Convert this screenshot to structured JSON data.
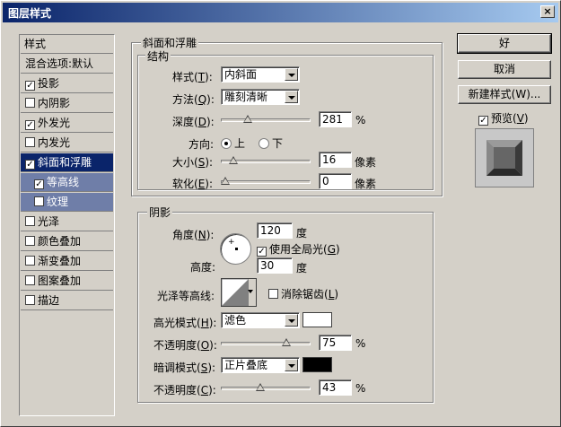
{
  "window": {
    "title": "图层样式",
    "close": "×"
  },
  "sidebar": {
    "items": [
      {
        "label": "样式",
        "checkbox": false
      },
      {
        "label": "混合选项:默认",
        "checkbox": false
      },
      {
        "label": "投影",
        "checkbox": true,
        "checked": true
      },
      {
        "label": "内阴影",
        "checkbox": true,
        "checked": false
      },
      {
        "label": "外发光",
        "checkbox": true,
        "checked": true
      },
      {
        "label": "内发光",
        "checkbox": true,
        "checked": false
      },
      {
        "label": "斜面和浮雕",
        "checkbox": true,
        "checked": true,
        "selected": true
      },
      {
        "label": "等高线",
        "checkbox": true,
        "checked": true,
        "sub": true
      },
      {
        "label": "纹理",
        "checkbox": true,
        "checked": false,
        "sub": true
      },
      {
        "label": "光泽",
        "checkbox": true,
        "checked": false
      },
      {
        "label": "颜色叠加",
        "checkbox": true,
        "checked": false
      },
      {
        "label": "渐变叠加",
        "checkbox": true,
        "checked": false
      },
      {
        "label": "图案叠加",
        "checkbox": true,
        "checked": false
      },
      {
        "label": "描边",
        "checkbox": true,
        "checked": false
      }
    ]
  },
  "bevel": {
    "group_title": "斜面和浮雕",
    "structure_title": "结构",
    "style_label": "样式",
    "style_key": "T",
    "style_value": "内斜面",
    "technique_label": "方法",
    "technique_key": "Q",
    "technique_value": "雕刻清晰",
    "depth_label": "深度",
    "depth_key": "D",
    "depth_value": "281",
    "depth_unit": "%",
    "depth_slider": 0.28,
    "direction_label": "方向:",
    "direction_up": "上",
    "direction_down": "下",
    "size_label": "大小",
    "size_key": "S",
    "size_value": "16",
    "size_unit": "像素",
    "size_slider": 0.1,
    "soften_label": "软化",
    "soften_key": "E",
    "soften_value": "0",
    "soften_unit": "像素",
    "soften_slider": 0.0
  },
  "shading": {
    "title": "阴影",
    "angle_label": "角度",
    "angle_key": "N",
    "angle_value": "120",
    "angle_unit": "度",
    "global_light_label": "使用全局光",
    "global_light_key": "G",
    "altitude_label": "高度:",
    "altitude_value": "30",
    "altitude_unit": "度",
    "gloss_label": "光泽等高线:",
    "antialias_label": "消除锯齿",
    "antialias_key": "L",
    "highlight_label": "高光模式",
    "highlight_key": "H",
    "highlight_value": "滤色",
    "highlight_color": "#ffffff",
    "hl_opacity_label": "不透明度",
    "hl_opacity_key": "O",
    "hl_opacity_value": "75",
    "hl_opacity_unit": "%",
    "hl_opacity_slider": 0.75,
    "shadow_label": "暗调模式",
    "shadow_key": "S",
    "shadow_value": "正片叠底",
    "shadow_color": "#000000",
    "sh_opacity_label": "不透明度",
    "sh_opacity_key": "C",
    "sh_opacity_value": "43",
    "sh_opacity_unit": "%",
    "sh_opacity_slider": 0.43
  },
  "buttons": {
    "ok": "好",
    "cancel": "取消",
    "new_style": "新建样式(W)...",
    "preview_label": "预览",
    "preview_key": "V"
  }
}
